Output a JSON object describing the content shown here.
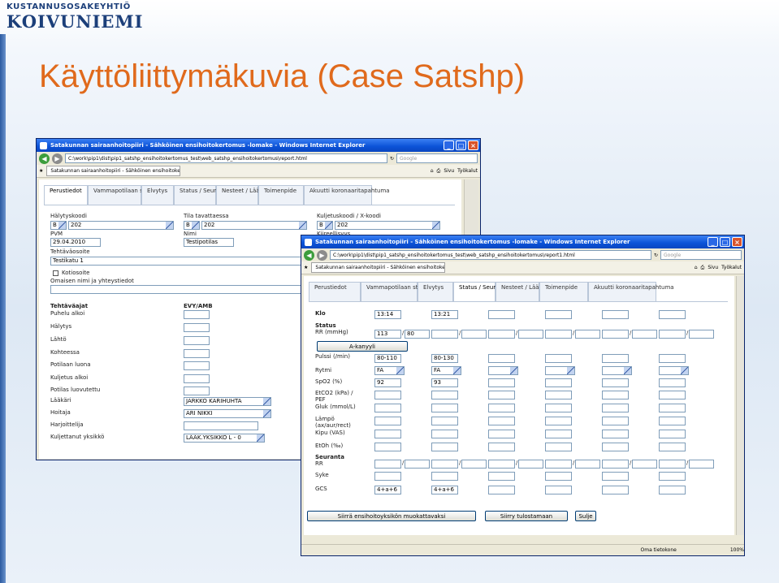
{
  "slide": {
    "logo_top": "KUSTANNUSOSAKEYHTIÖ",
    "logo_main": "KOIVUNIEMI",
    "title": "Käyttöliittymäkuvia (Case Satshp)"
  },
  "browser": {
    "window_title": "Satakunnan sairaanhoitopiiri - Sähköinen ensihoitokertomus -lomake - Windows Internet Explorer",
    "address_win1": "C:\\work\\pip1\\dist\\pip1_satshp_ensihoitokertomus_test\\web_satshp_ensihoitokertomus\\report.html",
    "address_win2": "C:\\work\\pip1\\dist\\pip1_satshp_ensihoitokertomus_test\\web_satshp_ensihoitokertomus\\report1.html",
    "search_placeholder": "Google",
    "tab_label": "Satakunnan sairaanhoitopiiri - Sähköinen ensihoitokert...",
    "tool_sivu": "Sivu",
    "tool_tyokalut": "Työkalut",
    "status_zone": "Oma tietokone",
    "zoom": "100%"
  },
  "tabs": [
    "Perustiedot",
    "Vammapotilaan status",
    "Elvytys",
    "Status / Seuranta",
    "Nesteet / Lääkkeet",
    "Toimenpide",
    "Akuutti koronaaritapahtuma"
  ],
  "form1": {
    "halytyskoodi_label": "Hälytyskoodi",
    "halytyskoodi_a": "B",
    "halytyskoodi_b": "202",
    "tila_label": "Tila tavattaessa",
    "tila_a": "B",
    "tila_b": "202",
    "kuljetus_label": "Kuljetuskoodi / X-koodi",
    "kuljetus_a": "B",
    "kuljetus_b": "202",
    "kiireellisyys_label": "Kiireellisyys",
    "pvm_label": "PVM",
    "pvm_value": "29.04.2010",
    "nimi_label": "Nimi",
    "nimi_value": "Testipotilas",
    "osoite_label": "Tehtäväosoite",
    "osoite_value": "Testikatu 1",
    "kotiosoite_label": "Kotiosoite",
    "omainen_label": "Omaisen nimi ja yhteystiedot",
    "ajat_header": "Tehtäväajat",
    "evy_header": "EVY/AMB",
    "time_rows": [
      "Puhelu alkoi",
      "Hälytys",
      "Lähtö",
      "Kohteessa",
      "Potilaan luona",
      "Kuljetus alkoi",
      "Potilas luovutettu"
    ],
    "laakari_label": "Lääkäri",
    "laakari_value": "JARKKO KARIHUHTA",
    "hoitaja_label": "Hoitaja",
    "hoitaja_value": "ARI NIKKI",
    "harjoittelija_label": "Harjoittelija",
    "yksikko_label": "Kuljettanut yksikkö",
    "yksikko_value": "LÄÄK.YKSIKKÖ L - 0"
  },
  "form2": {
    "klo_label": "Klo",
    "klo_1": "13:14",
    "klo_2": "13:21",
    "status_label": "Status",
    "rr_label": "RR (mmHg)",
    "rr_sys": "113",
    "rr_dia": "80",
    "akanyyli_button": "A-kanyyli",
    "pulssi_label": "Pulssi (/min)",
    "pulssi_1": "80-110",
    "pulssi_2": "80-130",
    "rytmi_label": "Rytmi",
    "rytmi_1": "FA",
    "rytmi_2": "FA",
    "spo2_label": "SpO2 (%)",
    "spo2_1": "92",
    "spo2_2": "93",
    "etco2_label": "EtCO2 (kPa) / PEF",
    "gluk_label": "Gluk (mmol/L)",
    "lampo_label": "Lämpö (ax/aur/rect)",
    "kipu_label": "Kipu (VAS)",
    "etoh_label": "EtOh (‰)",
    "seuranta_label": "Seuranta",
    "seuranta_rr_label": "RR",
    "syke_label": "Syke",
    "gcs_label": "GCS",
    "gcs_1": "4+a+6",
    "gcs_2": "4+a+6",
    "btn_move": "Siirrä ensihoitoyksikön muokattavaksi",
    "btn_print": "Siirry tulostamaan",
    "btn_close": "Sulje"
  },
  "colors": {
    "title_orange": "#e06a1c",
    "xp_titlebar": "#0b52d7",
    "logo_blue": "#1c3f7a"
  }
}
